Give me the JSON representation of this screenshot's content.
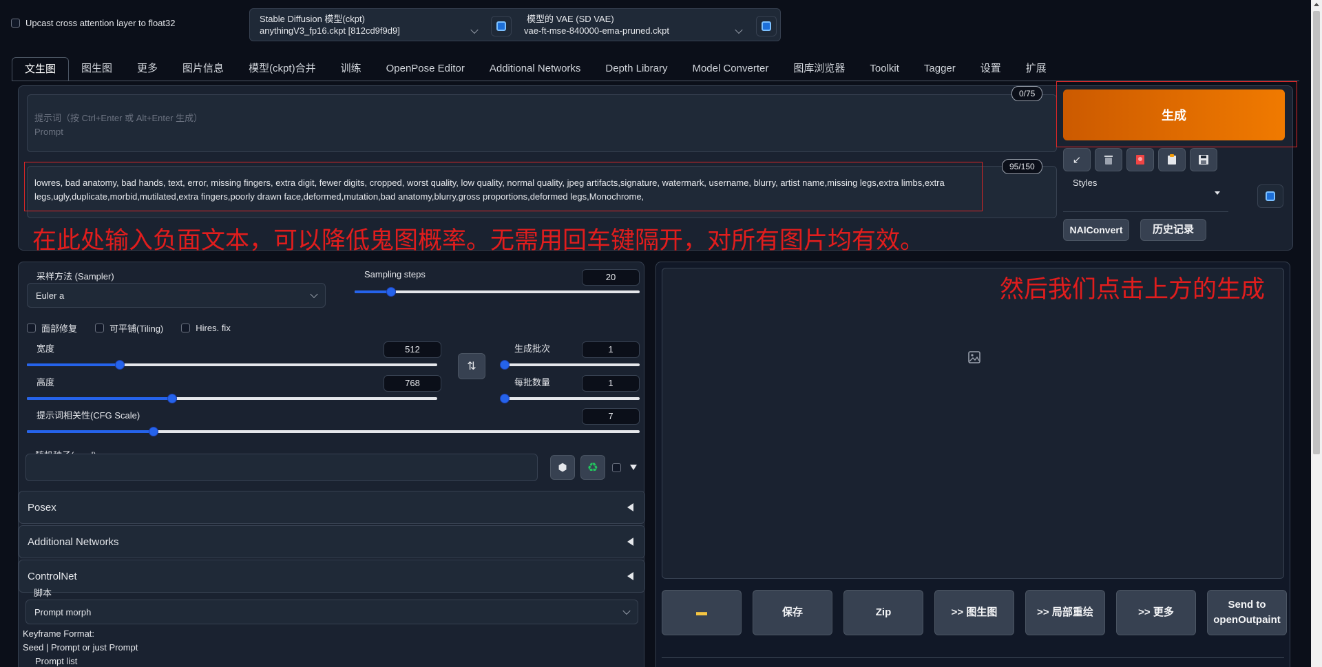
{
  "top": {
    "upcast_label": "Upcast cross attention layer to float32",
    "ckpt_label": "Stable Diffusion 模型(ckpt)",
    "ckpt_value": "anythingV3_fp16.ckpt [812cd9f9d9]",
    "vae_label": "模型的 VAE (SD VAE)",
    "vae_value": "vae-ft-mse-840000-ema-pruned.ckpt"
  },
  "tabs": [
    "文生图",
    "图生图",
    "更多",
    "图片信息",
    "模型(ckpt)合并",
    "训练",
    "OpenPose Editor",
    "Additional Networks",
    "Depth Library",
    "Model Converter",
    "图库浏览器",
    "Toolkit",
    "Tagger",
    "设置",
    "扩展"
  ],
  "prompt": {
    "counter": "0/75",
    "placeholder_line1": "提示词（按 Ctrl+Enter 或 Alt+Enter 生成）",
    "placeholder_line2": "Prompt"
  },
  "negative": {
    "counter": "95/150",
    "text": "lowres, bad anatomy, bad hands, text, error, missing fingers, extra digit, fewer digits, cropped, worst quality, low quality, normal quality, jpeg artifacts,signature, watermark, username, blurry, artist name,missing legs,extra limbs,extra legs,ugly,duplicate,morbid,mutilated,extra fingers,poorly drawn face,deformed,mutation,bad anatomy,blurry,gross proportions,deformed legs,Monochrome,"
  },
  "annotations": {
    "negative_hint": "在此处输入负面文本，可以降低鬼图概率。无需用回车键隔开，对所有图片均有效。",
    "generate_hint": "然后我们点击上方的生成"
  },
  "generate_label": "生成",
  "styles_label": "Styles",
  "naiconvert_label": "NAIConvert",
  "history_label": "历史记录",
  "sampler": {
    "label": "采样方法 (Sampler)",
    "value": "Euler a"
  },
  "steps": {
    "label": "Sampling steps",
    "value": 20,
    "min": 1,
    "max": 150
  },
  "checkboxes": [
    "面部修复",
    "可平铺(Tiling)",
    "Hires. fix"
  ],
  "width": {
    "label": "宽度",
    "value": 512,
    "min": 64,
    "max": 2048
  },
  "height": {
    "label": "高度",
    "value": 768,
    "min": 64,
    "max": 2048
  },
  "batch_count": {
    "label": "生成批次",
    "value": 1,
    "min": 1,
    "max": 100
  },
  "batch_size": {
    "label": "每批数量",
    "value": 1,
    "min": 1,
    "max": 8
  },
  "cfg": {
    "label": "提示词相关性(CFG Scale)",
    "value": 7,
    "min": 1,
    "max": 30
  },
  "seed": {
    "label": "随机种子(seed)",
    "value": ""
  },
  "accordions": [
    "Posex",
    "Additional Networks",
    "ControlNet"
  ],
  "script": {
    "label": "脚本",
    "value": "Prompt morph",
    "line1": "Keyframe Format:",
    "line2": "Seed | Prompt or just Prompt",
    "line3": "Prompt list"
  },
  "output_buttons": {
    "save": "保存",
    "zip": "Zip",
    "to_img2img": ">> 图生图",
    "to_inpaint": ">> 局部重绘",
    "to_extras": ">> 更多",
    "send_openoutpaint": "Send to openOutpaint"
  },
  "colors": {
    "accent": "#ea6a00",
    "annotation": "#e11d1d",
    "slider": "#2563eb"
  }
}
